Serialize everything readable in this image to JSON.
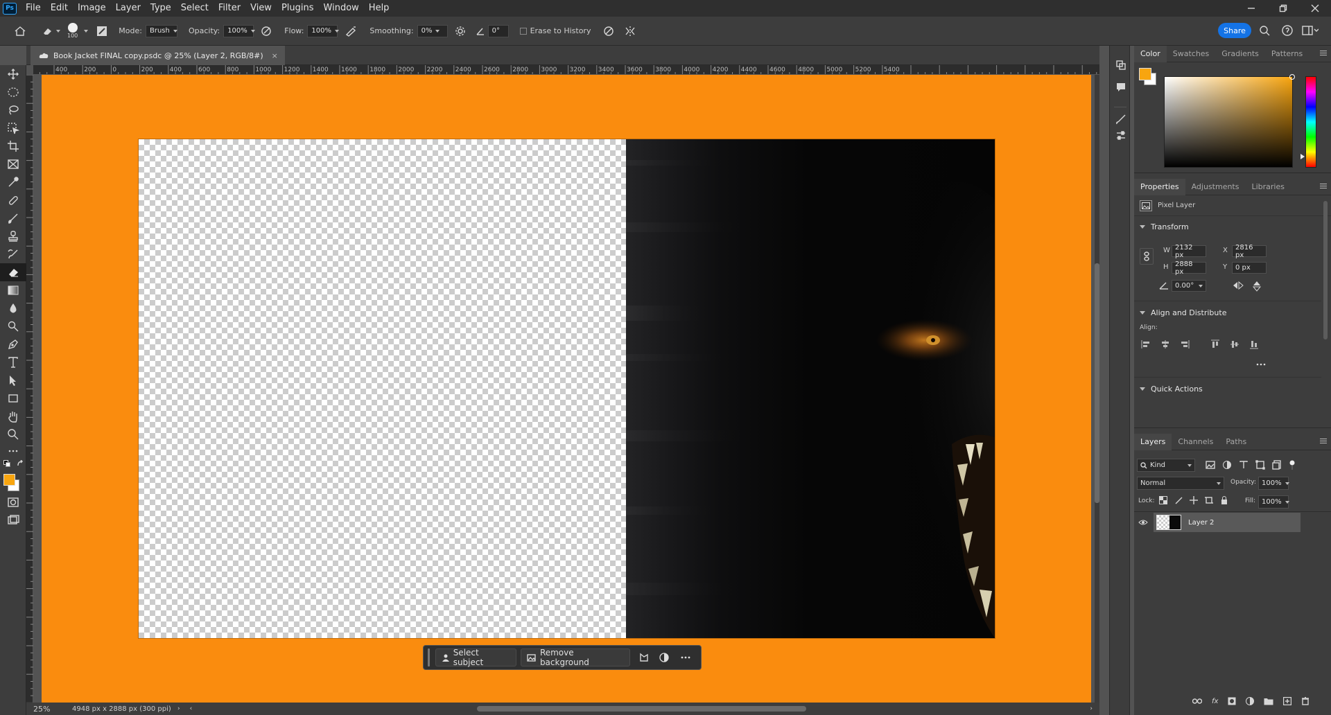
{
  "app": {
    "logo": "Ps"
  },
  "menubar": {
    "items": [
      "File",
      "Edit",
      "Image",
      "Layer",
      "Type",
      "Select",
      "Filter",
      "View",
      "Plugins",
      "Window",
      "Help"
    ]
  },
  "options_bar": {
    "brush_size": "100",
    "mode_label": "Mode:",
    "mode_value": "Brush",
    "opacity_label": "Opacity:",
    "opacity_value": "100%",
    "flow_label": "Flow:",
    "flow_value": "100%",
    "smoothing_label": "Smoothing:",
    "smoothing_value": "0%",
    "angle_value": "0°",
    "erase_history_label": "Erase to History",
    "share_label": "Share"
  },
  "document": {
    "tab_title": "Book Jacket FINAL copy.psdc @ 25% (Layer 2, RGB/8#)",
    "ruler_labels": [
      "400",
      "200",
      "0",
      "200",
      "400",
      "600",
      "800",
      "1000",
      "1200",
      "1400",
      "1600",
      "1800",
      "2000",
      "2200",
      "2400",
      "2600",
      "2800",
      "3000",
      "3200",
      "3400",
      "3600",
      "3800",
      "4000",
      "4200",
      "4400",
      "4600",
      "4800",
      "5000",
      "5200",
      "5400"
    ],
    "zoom": "25%",
    "doc_info": "4948 px x 2888 px (300 ppi)",
    "orange_color": "#fa8c0e"
  },
  "context_bar": {
    "select_subject": "Select subject",
    "remove_background": "Remove background"
  },
  "color_panel": {
    "tabs": [
      "Color",
      "Swatches",
      "Gradients",
      "Patterns"
    ],
    "foreground": "#f8a50f",
    "background": "#ffffff"
  },
  "properties_panel": {
    "tabs": [
      "Properties",
      "Adjustments",
      "Libraries"
    ],
    "layer_kind": "Pixel Layer",
    "transform_title": "Transform",
    "w_label": "W",
    "w_value": "2132 px",
    "h_label": "H",
    "h_value": "2888 px",
    "x_label": "X",
    "x_value": "2816 px",
    "y_label": "Y",
    "y_value": "0 px",
    "angle_value": "0.00°",
    "align_title": "Align and Distribute",
    "align_label": "Align:",
    "quick_actions_title": "Quick Actions"
  },
  "layers_panel": {
    "tabs": [
      "Layers",
      "Channels",
      "Paths"
    ],
    "kind_filter": "Kind",
    "blend_mode": "Normal",
    "opacity_label": "Opacity:",
    "opacity_value": "100%",
    "lock_label": "Lock:",
    "fill_label": "Fill:",
    "fill_value": "100%",
    "layers": [
      {
        "name": "Layer 2"
      }
    ]
  }
}
